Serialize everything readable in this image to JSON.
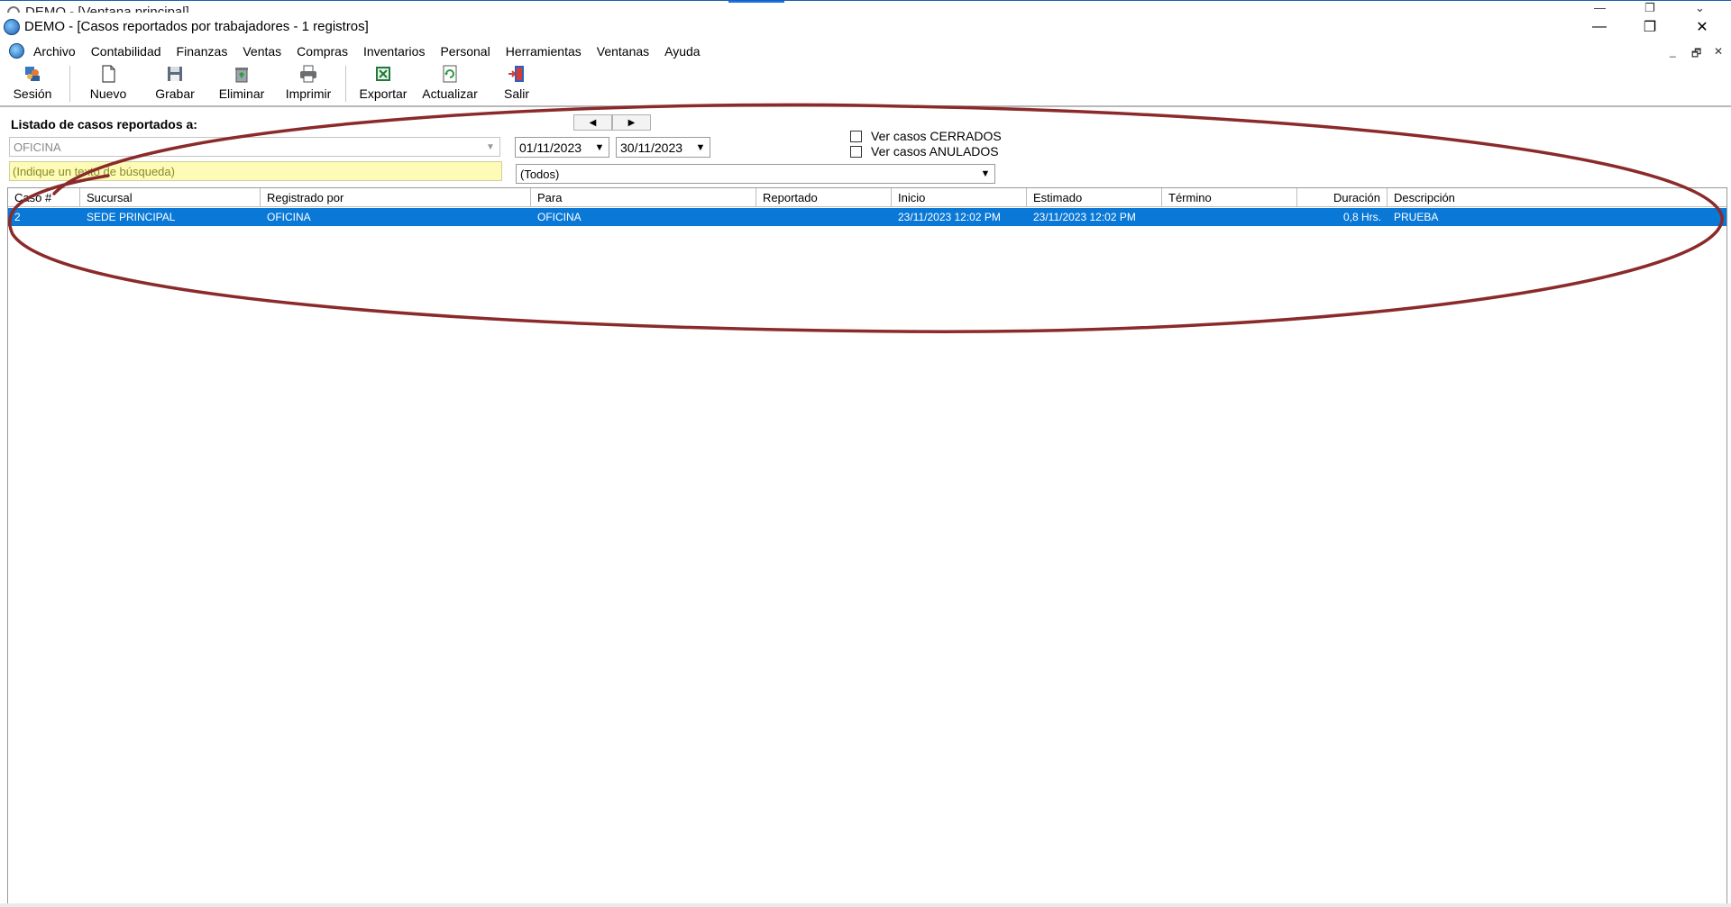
{
  "background_window": {
    "title": "DEMO - [Ventana principal]"
  },
  "window": {
    "title": "DEMO - [Casos reportados por trabajadores - 1 registros]",
    "controls": {
      "minimize": "—",
      "restore": "❐",
      "close": "✕"
    }
  },
  "menu": {
    "items": [
      "Archivo",
      "Contabilidad",
      "Finanzas",
      "Ventas",
      "Compras",
      "Inventarios",
      "Personal",
      "Herramientas",
      "Ventanas",
      "Ayuda"
    ],
    "mdi_controls": {
      "minimize": "_",
      "restore": "🗗",
      "close": "✕"
    }
  },
  "toolbar": {
    "sesion": "Sesión",
    "nuevo": "Nuevo",
    "grabar": "Grabar",
    "eliminar": "Eliminar",
    "imprimir": "Imprimir",
    "exportar": "Exportar",
    "actualizar": "Actualizar",
    "salir": "Salir"
  },
  "filters": {
    "title": "Listado de casos reportados a:",
    "reported_to": "OFICINA",
    "search_placeholder": "(Indique un texto de búsqueda)",
    "date_from": "01/11/2023",
    "date_to": "30/11/2023",
    "status": "(Todos)",
    "prev_label": "◀",
    "next_label": "▶",
    "check_closed": "Ver casos CERRADOS",
    "check_cancelled": "Ver casos ANULADOS"
  },
  "table": {
    "columns": [
      "Caso #",
      "Sucursal",
      "Registrado por",
      "Para",
      "Reportado",
      "Inicio",
      "Estimado",
      "Término",
      "Duración",
      "Descripción"
    ],
    "rows": [
      [
        "2",
        "SEDE PRINCIPAL",
        "OFICINA",
        "OFICINA",
        "",
        "23/11/2023 12:02 PM",
        "23/11/2023 12:02 PM",
        "",
        "0,8 Hrs.",
        "PRUEBA"
      ]
    ]
  },
  "colors": {
    "selected_row": "#0a78d6",
    "search_bg": "#fdfbb6",
    "annotation": "#8b2a2a"
  }
}
